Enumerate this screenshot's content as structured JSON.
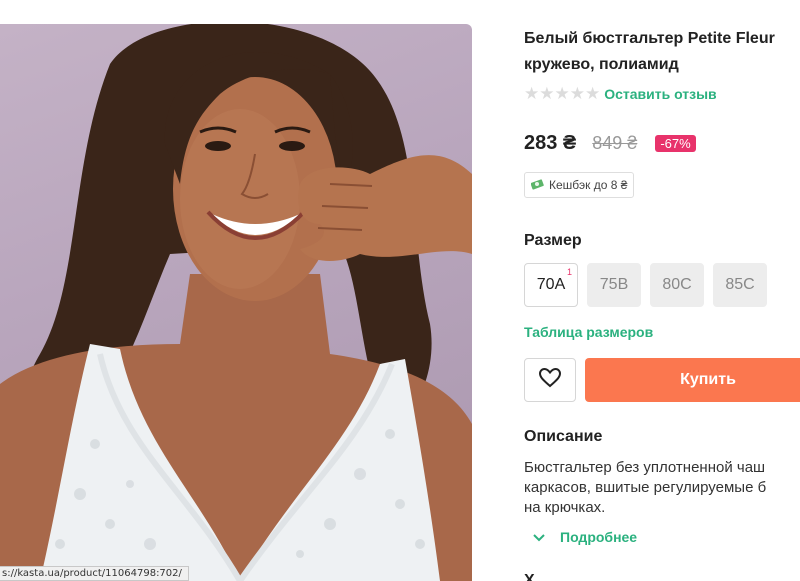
{
  "product": {
    "title_line1": "Белый бюстгальтер Petite Fleur",
    "title_line2": "кружево, полиамид",
    "rating": {
      "stars": "★★★★★",
      "filled": 0,
      "review_link": "Оставить отзыв"
    },
    "price": "283 ₴",
    "old_price": "849 ₴",
    "discount": "-67%",
    "cashback": "Кешбэк до 8 ₴"
  },
  "sizes": {
    "label": "Размер",
    "options": [
      {
        "label": "70A",
        "qty": "1",
        "available": true
      },
      {
        "label": "75B",
        "available": false
      },
      {
        "label": "80C",
        "available": false
      },
      {
        "label": "85C",
        "available": false
      }
    ],
    "table_link": "Таблица размеров"
  },
  "actions": {
    "buy_label": "Купить"
  },
  "description": {
    "heading": "Описание",
    "lines": [
      "Бюстгальтер без уплотненной чаш",
      "каркасов, вшитые регулируемые б",
      "на крючках."
    ],
    "more_label": "Подробнее",
    "next_heading": "Х"
  },
  "status_bar": {
    "url": "s://kasta.ua/product/11064798:702/"
  },
  "colors": {
    "accent_green": "#2bb17f",
    "buy_orange": "#fb774f",
    "discount_pink": "#e8336b"
  },
  "icons": {
    "favorite": "heart-icon",
    "cashback": "money-icon",
    "expand": "chevron-down-icon"
  }
}
